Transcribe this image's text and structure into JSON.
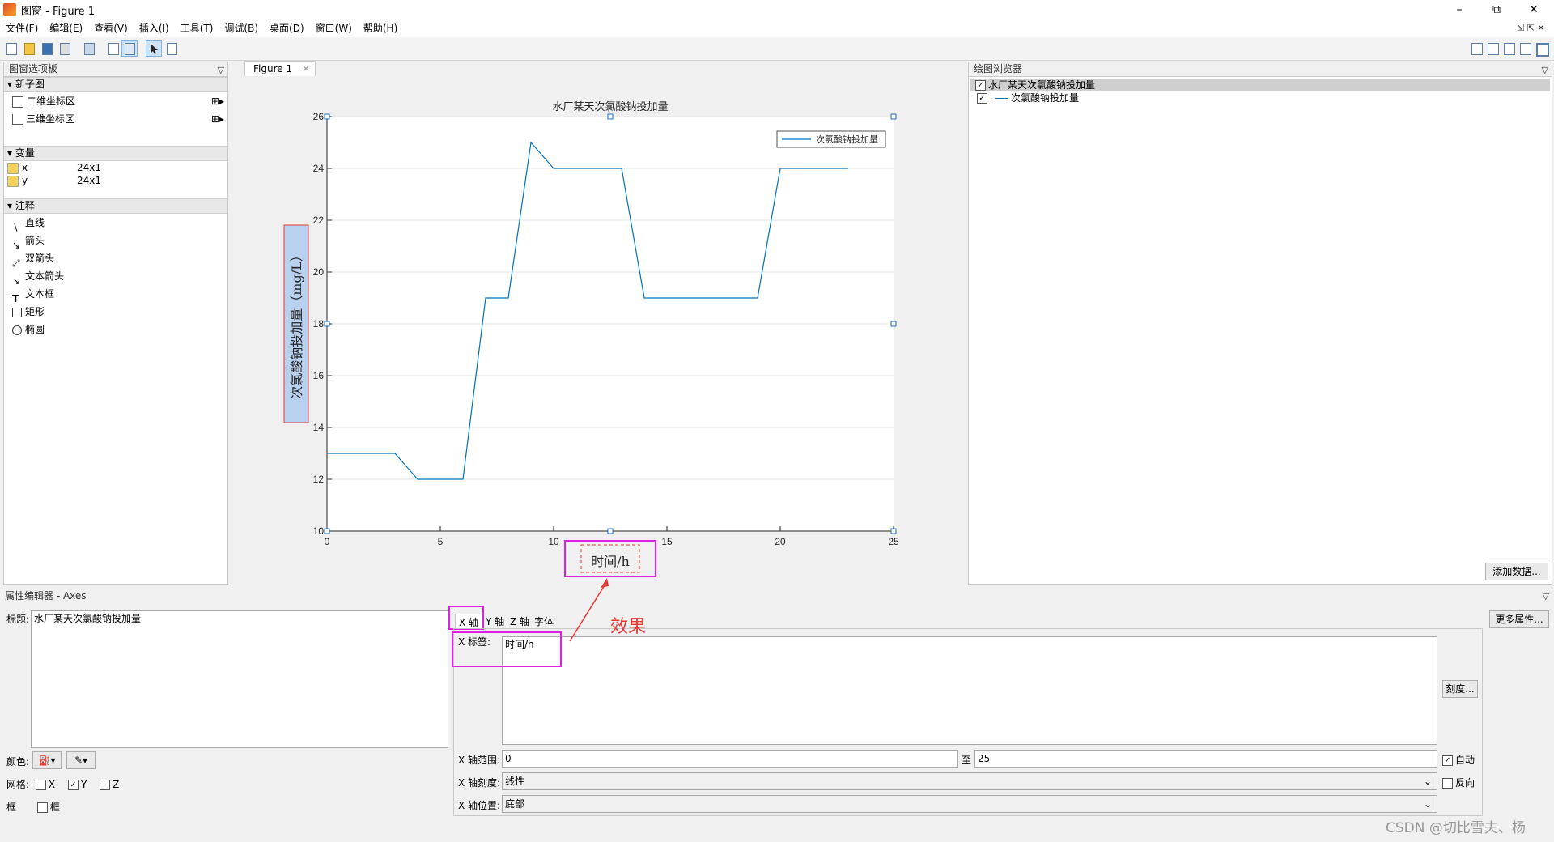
{
  "window": {
    "title": "图窗 - Figure 1"
  },
  "menu": [
    "文件(F)",
    "编辑(E)",
    "查看(V)",
    "插入(I)",
    "工具(T)",
    "调试(B)",
    "桌面(D)",
    "窗口(W)",
    "帮助(H)"
  ],
  "palette": {
    "title": "图窗选项板",
    "new_subplot": {
      "header": "新子图",
      "items": [
        "二维坐标区",
        "三维坐标区"
      ]
    },
    "variables": {
      "header": "变量",
      "items": [
        {
          "name": "x",
          "size": "24x1"
        },
        {
          "name": "y",
          "size": "24x1"
        }
      ]
    },
    "annotations": {
      "header": "注释",
      "items": [
        "直线",
        "箭头",
        "双箭头",
        "文本箭头",
        "文本框",
        "矩形",
        "椭圆"
      ]
    }
  },
  "figure_tab": "Figure 1",
  "browser": {
    "title": "绘图浏览器",
    "items": [
      "水厂某天次氯酸钠投加量",
      "次氯酸钠投加量"
    ],
    "add_data_button": "添加数据..."
  },
  "chart_data": {
    "type": "line",
    "title": "水厂某天次氯酸钠投加量",
    "xlabel": "时间/h",
    "ylabel": "次氯酸钠投加量（mg/L）",
    "xlim": [
      0,
      25
    ],
    "ylim": [
      10,
      26
    ],
    "xticks": [
      "0",
      "5",
      "10",
      "15",
      "20",
      "25"
    ],
    "yticks": [
      "10",
      "12",
      "14",
      "16",
      "18",
      "20",
      "22",
      "24",
      "26"
    ],
    "legend": "top-right",
    "grid": "y",
    "series": [
      {
        "name": "次氯酸钠投加量",
        "x": [
          0,
          1,
          2,
          3,
          4,
          5,
          6,
          7,
          8,
          9,
          10,
          11,
          12,
          13,
          14,
          15,
          16,
          17,
          18,
          19,
          20,
          21,
          22,
          23
        ],
        "y": [
          13,
          13,
          13,
          13,
          12,
          12,
          12,
          19,
          19,
          25,
          24,
          24,
          24,
          24,
          19,
          19,
          19,
          19,
          19,
          19,
          24,
          24,
          24,
          24
        ],
        "color": "#0072bd"
      }
    ]
  },
  "property_editor": {
    "title": "属性编辑器 - Axes",
    "title_label": "标题:",
    "title_value": "水厂某天次氯酸钠投加量",
    "tabs": [
      "X 轴",
      "Y 轴",
      "Z 轴",
      "字体"
    ],
    "more_props_button": "更多属性...",
    "xlabel_label": "X 标签:",
    "xlabel_value": "时间/h",
    "ticks_button": "刻度...",
    "xrange_label": "X 轴范围:",
    "xrange_from": "0",
    "xrange_to_label": "至",
    "xrange_to": "25",
    "auto_label": "自动",
    "xscale_label": "X 轴刻度:",
    "xscale_value": "线性",
    "reverse_label": "反向",
    "xloc_label": "X 轴位置:",
    "xloc_value": "底部",
    "color_label": "颜色:",
    "grid_label": "网格:",
    "grid_x": "X",
    "grid_y": "Y",
    "grid_z": "Z",
    "box_label": "框",
    "box_chk_label": "框"
  },
  "annotation_text": "效果",
  "watermark": "CSDN @切比雪夫、杨",
  "colors": {
    "line": "#0072bd",
    "highlight": "#e020e0",
    "arrow": "#e53935"
  }
}
